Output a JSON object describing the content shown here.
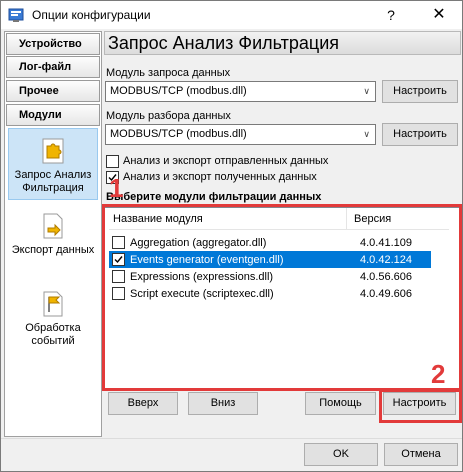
{
  "window": {
    "title": "Опции конфигурации",
    "help_glyph": "?",
    "close_glyph": "✕"
  },
  "nav": {
    "groups": [
      {
        "label": "Устройство"
      },
      {
        "label": "Лог-файл"
      },
      {
        "label": "Прочее"
      },
      {
        "label": "Модули"
      }
    ],
    "items": [
      {
        "label": "Запрос Анализ Фильтрация",
        "icon": "puzzle-icon",
        "selected": true
      },
      {
        "label": "Экспорт данных",
        "icon": "export-document-icon",
        "selected": false
      },
      {
        "label": "Обработка событий",
        "icon": "flag-icon",
        "selected": false
      }
    ]
  },
  "main": {
    "title": "Запрос Анализ Фильтрация",
    "query_module_label": "Модуль запроса данных",
    "query_module_value": "MODBUS/TCP (modbus.dll)",
    "parse_module_label": "Модуль разбора данных",
    "parse_module_value": "MODBUS/TCP (modbus.dll)",
    "configure_label": "Настроить",
    "check_sent_label": "Анализ и экспорт отправленных данных",
    "check_sent_checked": false,
    "check_received_label": "Анализ и экспорт полученных данных",
    "check_received_checked": true,
    "filter_section_title": "Выберите модули фильтрации данных",
    "list": {
      "col_name": "Название модуля",
      "col_version": "Версия",
      "rows": [
        {
          "name": "Aggregation (aggregator.dll)",
          "version": "4.0.41.109",
          "checked": false,
          "selected": false
        },
        {
          "name": "Events generator (eventgen.dll)",
          "version": "4.0.42.124",
          "checked": true,
          "selected": true
        },
        {
          "name": "Expressions (expressions.dll)",
          "version": "4.0.56.606",
          "checked": false,
          "selected": false
        },
        {
          "name": "Script execute (scriptexec.dll)",
          "version": "4.0.49.606",
          "checked": false,
          "selected": false
        }
      ]
    },
    "up_label": "Вверх",
    "down_label": "Вниз",
    "help_label": "Помощь",
    "configure_filter_label": "Настроить"
  },
  "footer": {
    "ok_label": "OK",
    "cancel_label": "Отмена"
  },
  "annotations": {
    "marker_1": "1",
    "marker_2": "2",
    "color": "#e23a3a"
  },
  "colors": {
    "selection": "#0078d7",
    "nav_selected": "#cce4f7"
  }
}
